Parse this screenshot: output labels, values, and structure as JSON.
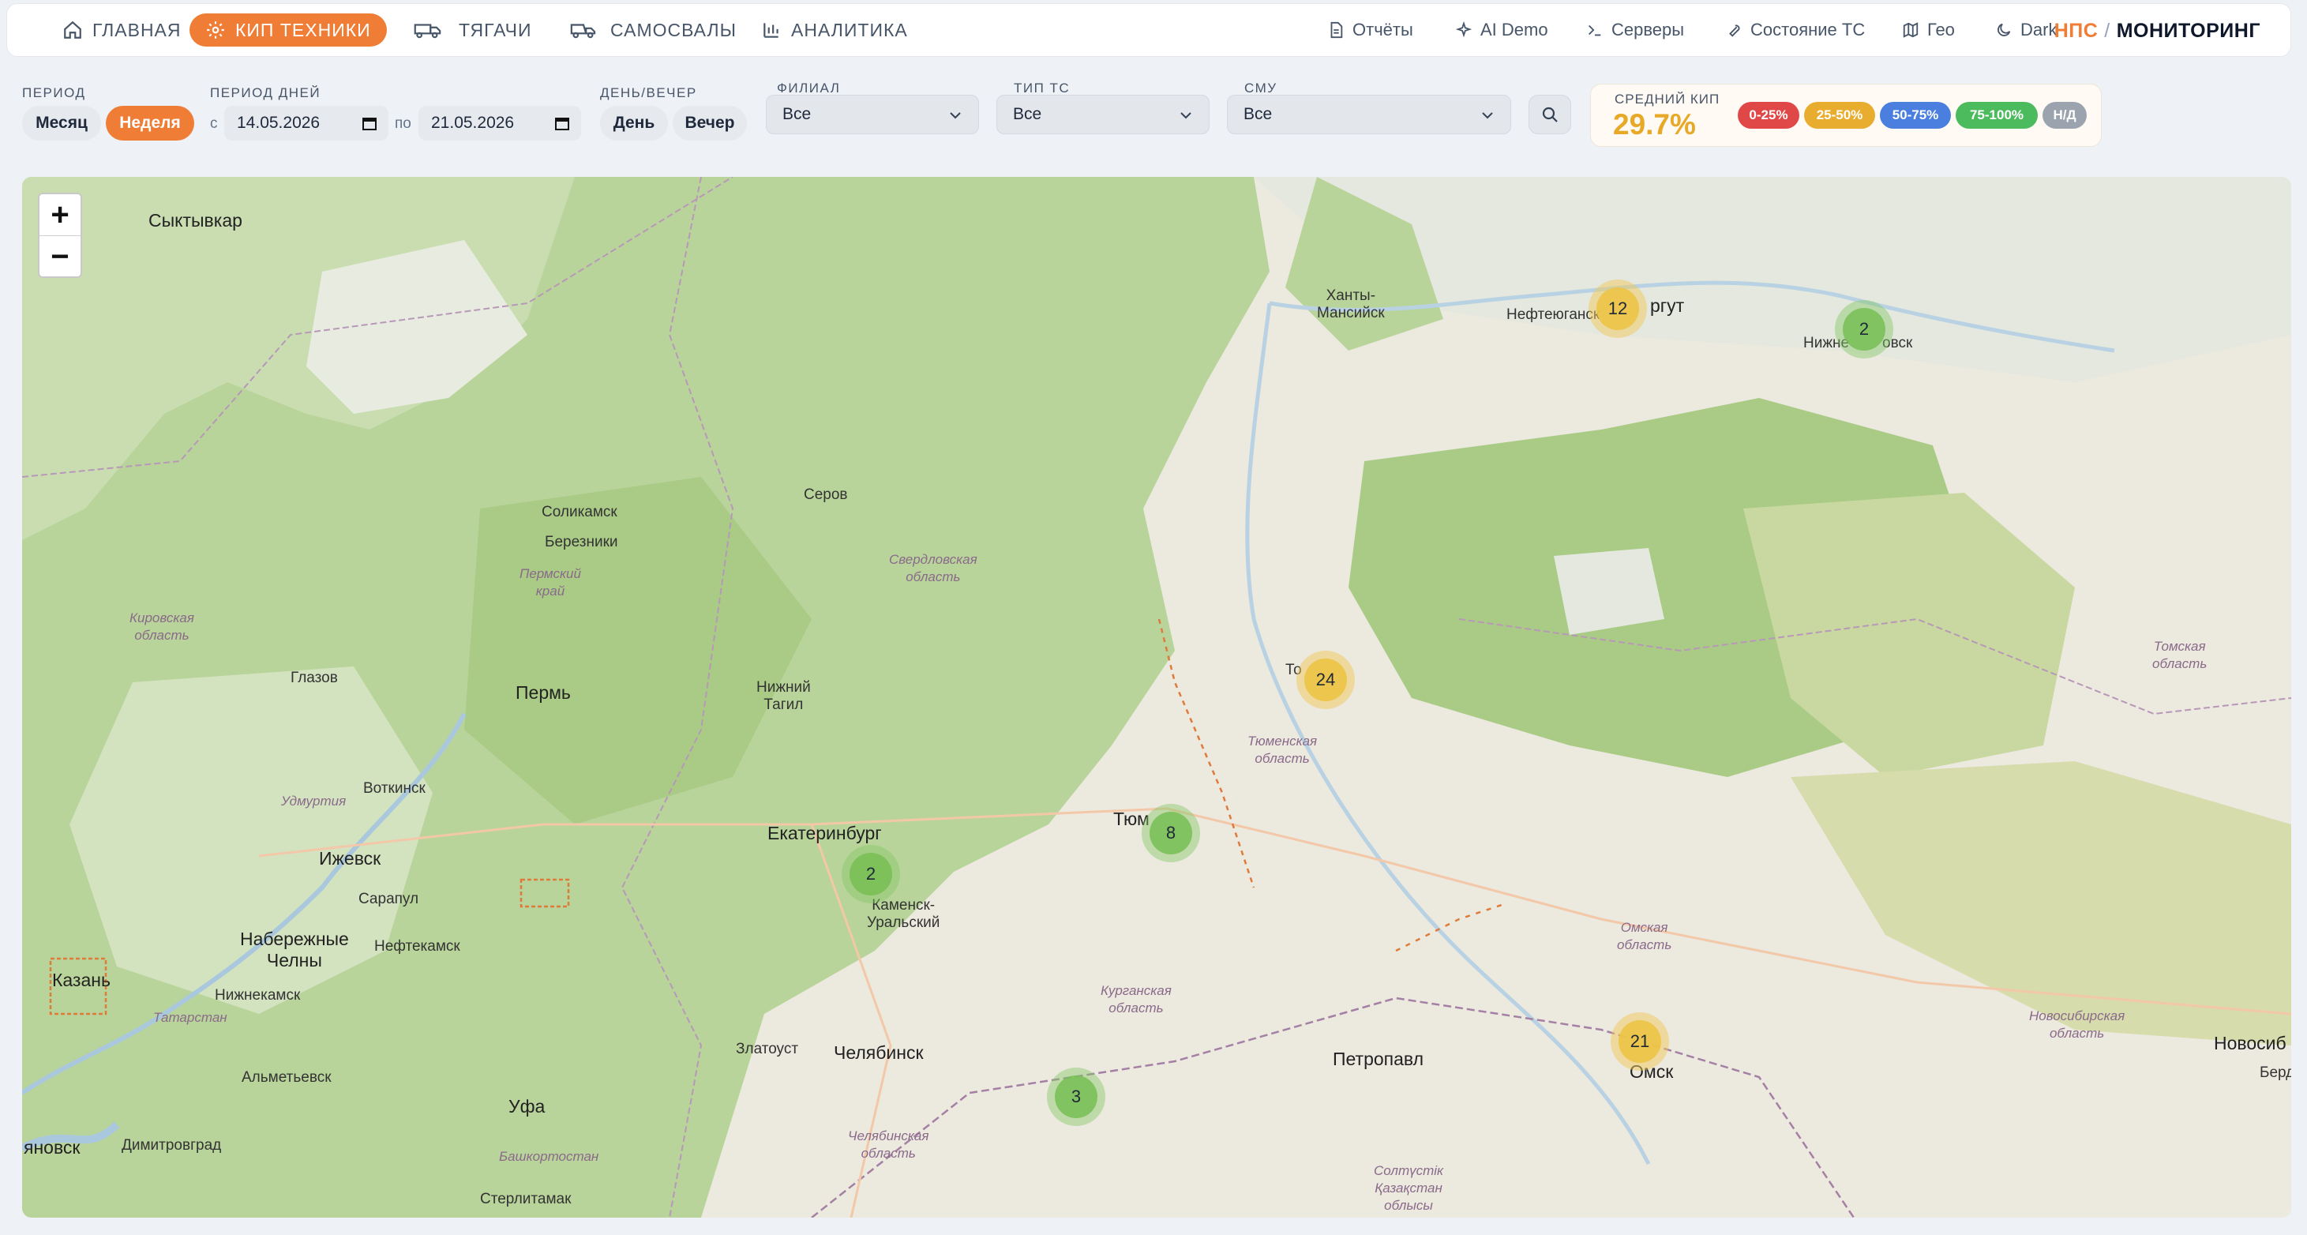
{
  "nav": {
    "items": [
      {
        "label": "ГЛАВНАЯ",
        "icon": "home-icon"
      },
      {
        "label": "КИП ТЕХНИКИ",
        "icon": "gear-icon",
        "active": true
      },
      {
        "label": "ТЯГАЧИ",
        "icon": "truck-icon"
      },
      {
        "label": "САМОСВАЛЫ",
        "icon": "dump-truck-icon"
      },
      {
        "label": "АНАЛИТИКА",
        "icon": "bar-chart-icon"
      }
    ],
    "right": [
      {
        "label": "Отчёты",
        "icon": "document-icon"
      },
      {
        "label": "AI Demo",
        "icon": "sparkles-icon"
      },
      {
        "label": "Серверы",
        "icon": "terminal-icon"
      },
      {
        "label": "Состояние ТС",
        "icon": "wrench-icon"
      },
      {
        "label": "Гео",
        "icon": "map-icon"
      },
      {
        "label": "Dark",
        "icon": "moon-icon"
      }
    ],
    "brand_left": "НПС",
    "brand_sep": "/",
    "brand_right": "МОНИТОРИНГ"
  },
  "filters": {
    "period_label": "ПЕРИОД",
    "period_month": "Месяц",
    "period_week": "Неделя",
    "days_label": "ПЕРИОД ДНЕЙ",
    "from_prefix": "с",
    "from_date": "14.05.2026",
    "to_prefix": "по",
    "to_date": "21.05.2026",
    "dayevening_label": "ДЕНЬ/ВЕЧЕР",
    "day": "День",
    "evening": "Вечер",
    "branch_label": "ФИЛИАЛ",
    "branch_value": "Все",
    "vehicle_type_label": "ТИП ТС",
    "vehicle_type_value": "Все",
    "smu_label": "СМУ",
    "smu_value": "Все"
  },
  "kip": {
    "title": "СРЕДНИЙ КИП",
    "value": "29.7%",
    "legend": [
      {
        "label": "0-25%",
        "color": "#e04848"
      },
      {
        "label": "25-50%",
        "color": "#e8ad2e"
      },
      {
        "label": "50-75%",
        "color": "#4a7fe0"
      },
      {
        "label": "75-100%",
        "color": "#4cbb5e"
      },
      {
        "label": "Н/Д",
        "color": "#9aa3ae"
      }
    ]
  },
  "map": {
    "zoom_in": "+",
    "zoom_out": "−",
    "clusters": [
      {
        "count": "12",
        "status": "yellow"
      },
      {
        "count": "2",
        "status": "green"
      },
      {
        "count": "24",
        "status": "yellow"
      },
      {
        "count": "8",
        "status": "green"
      },
      {
        "count": "2",
        "status": "green"
      },
      {
        "count": "3",
        "status": "green"
      },
      {
        "count": "21",
        "status": "yellow"
      }
    ],
    "cities": {
      "syktyvkar": "Сыктывкар",
      "khanty": "Ханты-\nМансийск",
      "nefteyugansk": "Нефтеюганск",
      "surgut": "ргут",
      "nizhnevartovsk": "Нижне",
      "nizhnevartovsk2": "овск",
      "serov": "Серов",
      "solikamsk": "Соликамск",
      "berezniki": "Березники",
      "perm": "Пермь",
      "glazov": "Глазов",
      "ntagil": "Нижний\nТагил",
      "tobolsk": "То",
      "ekb": "Екатеринбург",
      "tyumen": "Тюм",
      "votkinsk": "Воткинск",
      "izhevsk": "Ижевск",
      "sarapul": "Сарапул",
      "neftekamsk": "Нефтекамск",
      "kamensk": "Каменск-\nУральский",
      "chelny": "Набережные\nЧелны",
      "nizhnekamsk": "Нижнекамск",
      "kazan": "Казань",
      "almetyevsk": "Альметьевск",
      "zlatoust": "Златоуст",
      "chelyabinsk": "Челябинск",
      "petropavl": "Петропавл",
      "omsk": "Омск",
      "novosib": "Новосиб",
      "berd": "Берд",
      "ufa": "Уфа",
      "dimitrovgrad": "Димитровград",
      "ulyanovsk": "яновск",
      "sterlitamak": "Стерлитамак"
    },
    "regions": {
      "perm_krai": "Пермский\nкрай",
      "kirov": "Кировская\nобласть",
      "sverdlovsk": "Свердловская\nобласть",
      "tyumen": "Тюменская\nобласть",
      "udmurtia": "Удмуртия",
      "tatarstan": "Татарстан",
      "kurgan": "Курганская\nобласть",
      "omsk": "Омская\nобласть",
      "novosib": "Новосибирская\nобласть",
      "tomsk": "Томская\nобласть",
      "chelyabinsk": "Челябинская\nобласть",
      "bashkortostan": "Башкортостан",
      "kazakhstan": "Солтүстік\nҚазақстан\nоблысы"
    }
  }
}
